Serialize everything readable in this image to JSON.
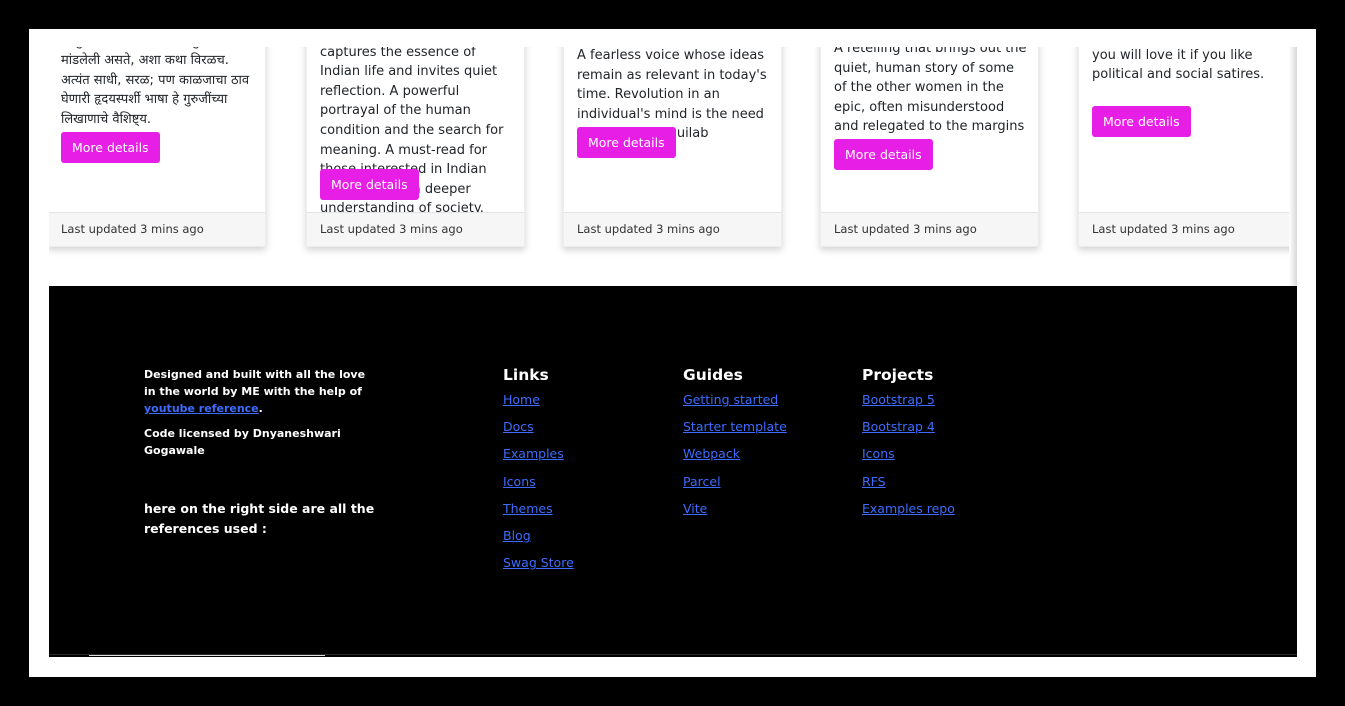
{
  "cards": [
    {
      "text": "ग्रामीण जीवनातील साधेपणा आणि आपुलकी क्वचितच इतक्या सुंदर रीतीने मांडलेली असते, अशा कथा विरळच. अत्यंत साधी, सरळ; पण काळजाचा ठाव घेणारी हृदयस्पर्शी भाषा हे गुरुजींच्या लिखाणाचे वैशिष्ट्य.",
      "button": "More details",
      "footer": "Last updated 3 mins ago"
    },
    {
      "text": "A timeless classic that captures the essence of Indian life and invites quiet reflection. A powerful portrayal of the human condition and the search for meaning. A must-read for those interested in Indian literature and a deeper understanding of society.",
      "button": "More details",
      "footer": "Last updated 3 mins ago"
    },
    {
      "text": "A fearless voice whose ideas remain as relevant in today's time. Revolution in an individual's mind is the need to the hour. Inquilab zindabad.",
      "button": "More details",
      "footer": "Last updated 3 mins ago"
    },
    {
      "text": "A retelling that brings out the quiet, human story of some of the other women in the epic, often misunderstood and relegated to the margins",
      "button": "More details",
      "footer": "Last updated 3 mins ago"
    },
    {
      "text": "A sharp and witty read that you will love it if you like political and social satires.",
      "button": "More details",
      "footer": "Last updated 3 mins ago"
    }
  ],
  "footer": {
    "credit_prefix": "Designed and built with all the love in the world by ME with the help of ",
    "credit_link": "youtube reference",
    "credit_suffix": ".",
    "license": "Code licensed by Dnyaneshwari Gogawale",
    "note": "here on the right side are all the references used :",
    "columns": [
      {
        "title": "Links",
        "items": [
          "Home",
          "Docs",
          "Examples",
          "Icons",
          "Themes",
          "Blog",
          "Swag Store"
        ]
      },
      {
        "title": "Guides",
        "items": [
          "Getting started",
          "Starter template",
          "Webpack",
          "Parcel",
          "Vite"
        ]
      },
      {
        "title": "Projects",
        "items": [
          "Bootstrap 5",
          "Bootstrap 4",
          "Icons",
          "RFS",
          "Examples repo"
        ]
      }
    ]
  }
}
